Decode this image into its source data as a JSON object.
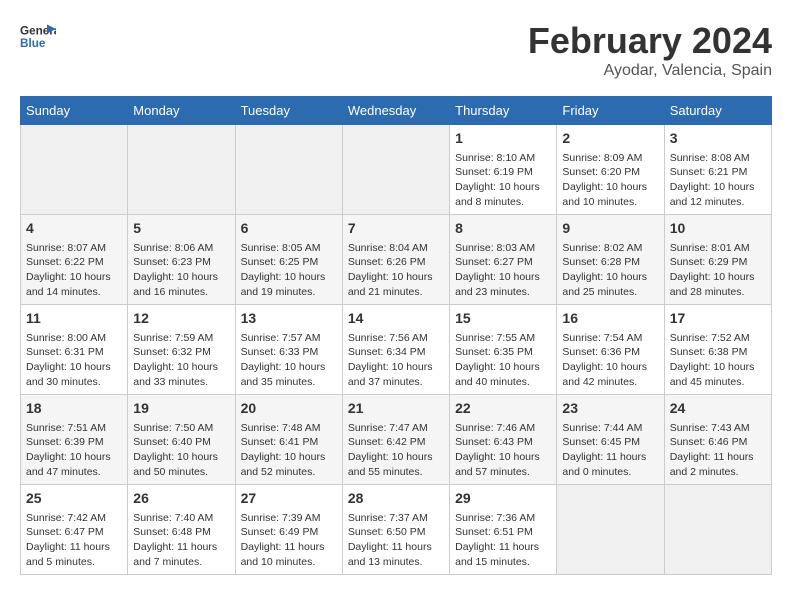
{
  "header": {
    "logo_general": "General",
    "logo_blue": "Blue",
    "title": "February 2024",
    "subtitle": "Ayodar, Valencia, Spain"
  },
  "days_of_week": [
    "Sunday",
    "Monday",
    "Tuesday",
    "Wednesday",
    "Thursday",
    "Friday",
    "Saturday"
  ],
  "weeks": [
    [
      {
        "day": "",
        "info": ""
      },
      {
        "day": "",
        "info": ""
      },
      {
        "day": "",
        "info": ""
      },
      {
        "day": "",
        "info": ""
      },
      {
        "day": "1",
        "info": "Sunrise: 8:10 AM\nSunset: 6:19 PM\nDaylight: 10 hours\nand 8 minutes."
      },
      {
        "day": "2",
        "info": "Sunrise: 8:09 AM\nSunset: 6:20 PM\nDaylight: 10 hours\nand 10 minutes."
      },
      {
        "day": "3",
        "info": "Sunrise: 8:08 AM\nSunset: 6:21 PM\nDaylight: 10 hours\nand 12 minutes."
      }
    ],
    [
      {
        "day": "4",
        "info": "Sunrise: 8:07 AM\nSunset: 6:22 PM\nDaylight: 10 hours\nand 14 minutes."
      },
      {
        "day": "5",
        "info": "Sunrise: 8:06 AM\nSunset: 6:23 PM\nDaylight: 10 hours\nand 16 minutes."
      },
      {
        "day": "6",
        "info": "Sunrise: 8:05 AM\nSunset: 6:25 PM\nDaylight: 10 hours\nand 19 minutes."
      },
      {
        "day": "7",
        "info": "Sunrise: 8:04 AM\nSunset: 6:26 PM\nDaylight: 10 hours\nand 21 minutes."
      },
      {
        "day": "8",
        "info": "Sunrise: 8:03 AM\nSunset: 6:27 PM\nDaylight: 10 hours\nand 23 minutes."
      },
      {
        "day": "9",
        "info": "Sunrise: 8:02 AM\nSunset: 6:28 PM\nDaylight: 10 hours\nand 25 minutes."
      },
      {
        "day": "10",
        "info": "Sunrise: 8:01 AM\nSunset: 6:29 PM\nDaylight: 10 hours\nand 28 minutes."
      }
    ],
    [
      {
        "day": "11",
        "info": "Sunrise: 8:00 AM\nSunset: 6:31 PM\nDaylight: 10 hours\nand 30 minutes."
      },
      {
        "day": "12",
        "info": "Sunrise: 7:59 AM\nSunset: 6:32 PM\nDaylight: 10 hours\nand 33 minutes."
      },
      {
        "day": "13",
        "info": "Sunrise: 7:57 AM\nSunset: 6:33 PM\nDaylight: 10 hours\nand 35 minutes."
      },
      {
        "day": "14",
        "info": "Sunrise: 7:56 AM\nSunset: 6:34 PM\nDaylight: 10 hours\nand 37 minutes."
      },
      {
        "day": "15",
        "info": "Sunrise: 7:55 AM\nSunset: 6:35 PM\nDaylight: 10 hours\nand 40 minutes."
      },
      {
        "day": "16",
        "info": "Sunrise: 7:54 AM\nSunset: 6:36 PM\nDaylight: 10 hours\nand 42 minutes."
      },
      {
        "day": "17",
        "info": "Sunrise: 7:52 AM\nSunset: 6:38 PM\nDaylight: 10 hours\nand 45 minutes."
      }
    ],
    [
      {
        "day": "18",
        "info": "Sunrise: 7:51 AM\nSunset: 6:39 PM\nDaylight: 10 hours\nand 47 minutes."
      },
      {
        "day": "19",
        "info": "Sunrise: 7:50 AM\nSunset: 6:40 PM\nDaylight: 10 hours\nand 50 minutes."
      },
      {
        "day": "20",
        "info": "Sunrise: 7:48 AM\nSunset: 6:41 PM\nDaylight: 10 hours\nand 52 minutes."
      },
      {
        "day": "21",
        "info": "Sunrise: 7:47 AM\nSunset: 6:42 PM\nDaylight: 10 hours\nand 55 minutes."
      },
      {
        "day": "22",
        "info": "Sunrise: 7:46 AM\nSunset: 6:43 PM\nDaylight: 10 hours\nand 57 minutes."
      },
      {
        "day": "23",
        "info": "Sunrise: 7:44 AM\nSunset: 6:45 PM\nDaylight: 11 hours\nand 0 minutes."
      },
      {
        "day": "24",
        "info": "Sunrise: 7:43 AM\nSunset: 6:46 PM\nDaylight: 11 hours\nand 2 minutes."
      }
    ],
    [
      {
        "day": "25",
        "info": "Sunrise: 7:42 AM\nSunset: 6:47 PM\nDaylight: 11 hours\nand 5 minutes."
      },
      {
        "day": "26",
        "info": "Sunrise: 7:40 AM\nSunset: 6:48 PM\nDaylight: 11 hours\nand 7 minutes."
      },
      {
        "day": "27",
        "info": "Sunrise: 7:39 AM\nSunset: 6:49 PM\nDaylight: 11 hours\nand 10 minutes."
      },
      {
        "day": "28",
        "info": "Sunrise: 7:37 AM\nSunset: 6:50 PM\nDaylight: 11 hours\nand 13 minutes."
      },
      {
        "day": "29",
        "info": "Sunrise: 7:36 AM\nSunset: 6:51 PM\nDaylight: 11 hours\nand 15 minutes."
      },
      {
        "day": "",
        "info": ""
      },
      {
        "day": "",
        "info": ""
      }
    ]
  ]
}
